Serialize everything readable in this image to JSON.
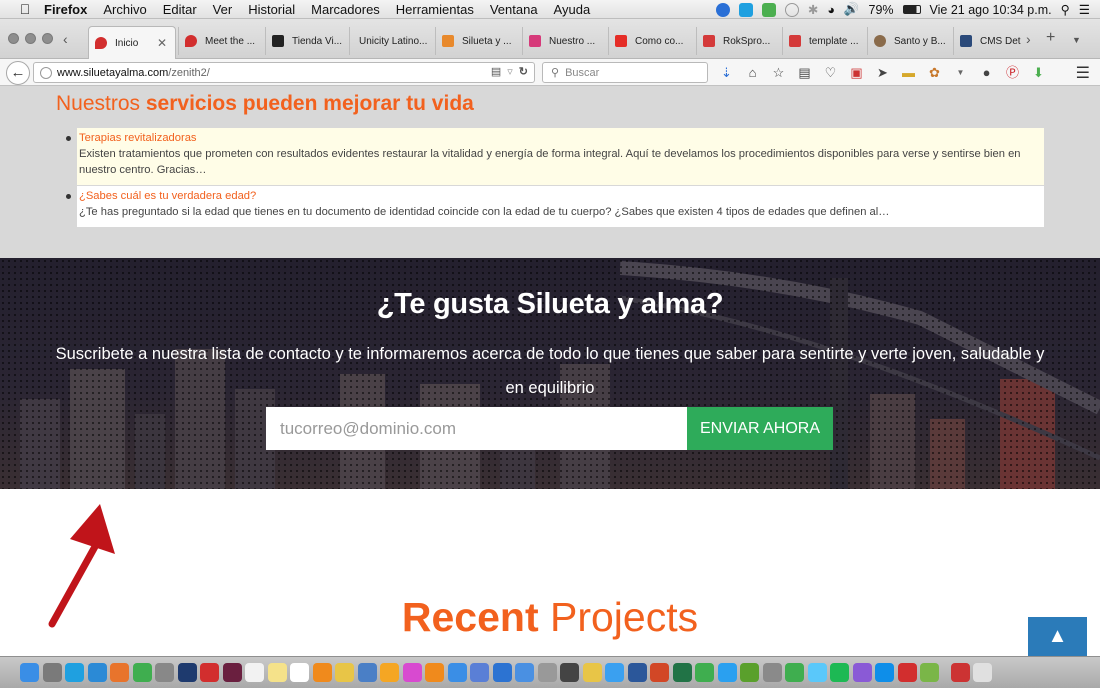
{
  "menubar": {
    "app": "Firefox",
    "items": [
      "Archivo",
      "Editar",
      "Ver",
      "Historial",
      "Marcadores",
      "Herramientas",
      "Ventana",
      "Ayuda"
    ],
    "battery": "79%",
    "datetime": "Vie 21 ago  10:34 p.m."
  },
  "tabs": [
    {
      "label": "Inicio",
      "icon": "siluetayalma-icon",
      "color": "#d22e2e"
    },
    {
      "label": "Meet the ...",
      "icon": "siluetayalma-icon",
      "color": "#d22e2e"
    },
    {
      "label": "Tienda Vi...",
      "icon": "github-icon",
      "color": "#222222"
    },
    {
      "label": "Unicity Latino...",
      "icon": "",
      "color": ""
    },
    {
      "label": "Silueta y ...",
      "icon": "joomla-icon",
      "color": "#e8892c"
    },
    {
      "label": "Nuestro ...",
      "icon": "site-icon",
      "color": "#d63a7a"
    },
    {
      "label": "Como co...",
      "icon": "youtube-icon",
      "color": "#e52d27"
    },
    {
      "label": "RokSpro...",
      "icon": "rockettheme-icon",
      "color": "#d43a3a"
    },
    {
      "label": "template ...",
      "icon": "rockettheme-icon",
      "color": "#d43a3a"
    },
    {
      "label": "Santo y B...",
      "icon": "site-icon",
      "color": "#8a6b4b"
    },
    {
      "label": "CMS Det",
      "icon": "site-icon",
      "color": "#2b4a7a"
    }
  ],
  "navbar": {
    "url_host": "www.siluetayalma.com",
    "url_path": "/zenith2/",
    "search_placeholder": "Buscar"
  },
  "services": {
    "heading_a": "Nuestros ",
    "heading_b": "servicios pueden mejorar tu vida",
    "items": [
      {
        "title": "Terapias revitalizadoras",
        "desc": "Existen tratamientos que prometen con resultados evidentes restaurar la vitalidad y energía de forma integral. Aquí te develamos los procedimientos disponibles para verse y sentirse bien en nuestro centro. Gracias…"
      },
      {
        "title": "¿Sabes cuál es tu verdadera edad?",
        "desc": "¿Te has preguntado si la edad que tienes en tu documento de identidad coincide con la edad de tu cuerpo? ¿Sabes que existen 4 tipos de edades que definen al…"
      }
    ]
  },
  "subscribe": {
    "title": "¿Te gusta Silueta y alma?",
    "text": "Suscribete a nuestra lista de contacto y te informaremos acerca de todo lo que tienes que saber para sentirte y verte joven, saludable y en equilibrio",
    "email_placeholder": "tucorreo@dominio.com",
    "button": "ENVIAR AHORA"
  },
  "recent": {
    "bold": "Recent",
    "light": " Projects"
  },
  "colors": {
    "accent": "#f2611e",
    "button_green": "#2eab5a",
    "totop_blue": "#2b7bb9"
  },
  "dock_icons": [
    "finder-icon",
    "launchpad-icon",
    "skype-icon",
    "safari-icon",
    "firefox-icon",
    "chrome-icon",
    "app-icon",
    "photoshop-icon",
    "acrobat-icon",
    "indesign-icon",
    "calendar-icon",
    "notes-icon",
    "textedit-icon",
    "vlc-icon",
    "photos-icon",
    "quicktime-icon",
    "amazon-icon",
    "itunes-icon",
    "ibooks-icon",
    "appstore-icon",
    "app-icon",
    "app-icon",
    "download-icon",
    "app-icon",
    "radiation-icon",
    "popcorn-icon",
    "app-icon",
    "word-icon",
    "powerpoint-icon",
    "excel-icon",
    "app-icon",
    "app-icon",
    "evernote-icon",
    "app-icon",
    "facetime-icon",
    "messages-icon",
    "spotify-icon",
    "app-icon",
    "teamviewer-icon",
    "app-icon",
    "app-icon",
    "app-icon",
    "trash-icon"
  ]
}
